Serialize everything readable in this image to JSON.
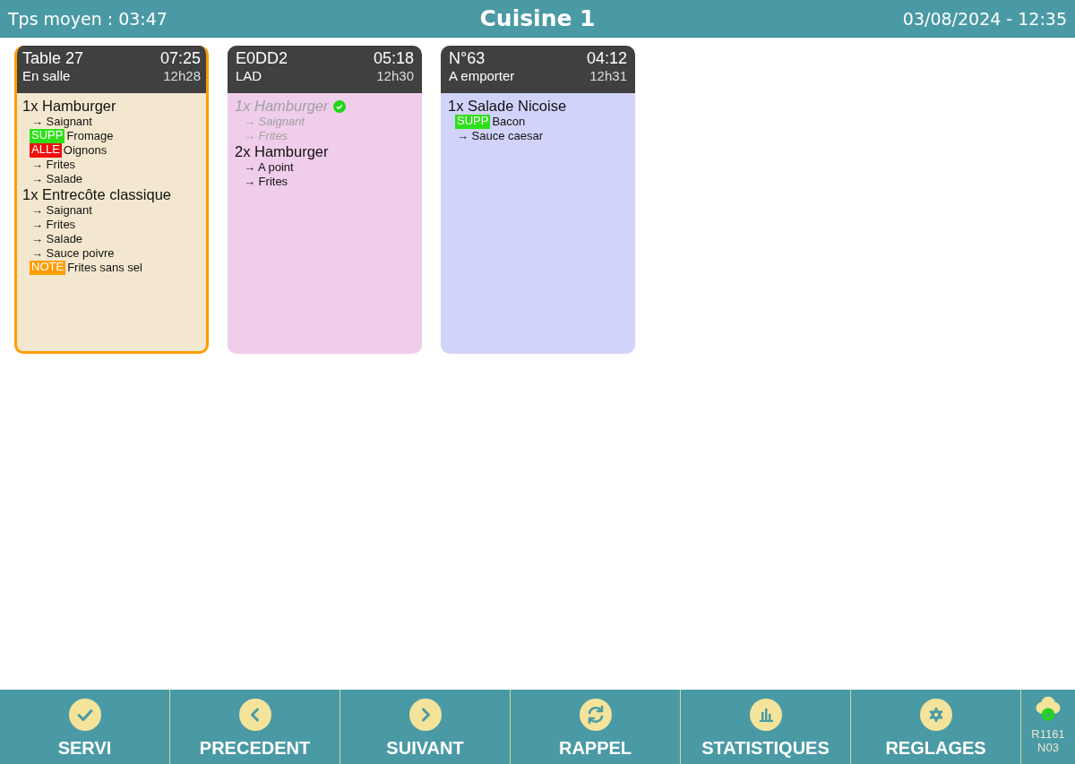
{
  "header": {
    "average_time": "Tps moyen : 03:47",
    "title": "Cuisine 1",
    "datetime": "03/08/2024 - 12:35"
  },
  "orders": [
    {
      "name": "Table 27",
      "timer": "07:25",
      "mode": "En salle",
      "time": "12h28",
      "color": "#f3e8cf",
      "selected": true,
      "items": [
        {
          "text": "1x Hamburger",
          "done": false,
          "lines": [
            {
              "kind": "option",
              "text": "→ Saignant"
            },
            {
              "kind": "tag",
              "tag": "SUPP",
              "color": "#2ee01a",
              "text": "Fromage"
            },
            {
              "kind": "tag",
              "tag": "ALLE",
              "color": "#f01010",
              "text": "Oignons"
            },
            {
              "kind": "option",
              "text": "→ Frites"
            },
            {
              "kind": "option",
              "text": "→ Salade"
            }
          ]
        },
        {
          "text": "1x Entrecôte classique",
          "done": false,
          "lines": [
            {
              "kind": "option",
              "text": "→ Saignant"
            },
            {
              "kind": "option",
              "text": "→ Frites"
            },
            {
              "kind": "option",
              "text": "→ Salade"
            },
            {
              "kind": "option",
              "text": "→ Sauce poivre"
            },
            {
              "kind": "tag",
              "tag": "NOTE",
              "color": "#ff9c00",
              "text": "Frites sans sel"
            }
          ]
        }
      ]
    },
    {
      "name": "E0DD2",
      "timer": "05:18",
      "mode": "LAD",
      "time": "12h30",
      "color": "#f0cdea",
      "selected": false,
      "items": [
        {
          "text": "1x Hamburger",
          "done": true,
          "lines": [
            {
              "kind": "option",
              "text": "→ Saignant"
            },
            {
              "kind": "option",
              "text": "→ Frites"
            }
          ]
        },
        {
          "text": "2x Hamburger",
          "done": false,
          "lines": [
            {
              "kind": "option",
              "text": "→ A point"
            },
            {
              "kind": "option",
              "text": "→ Frites"
            }
          ]
        }
      ]
    },
    {
      "name": "N°63",
      "timer": "04:12",
      "mode": "A emporter",
      "time": "12h31",
      "color": "#d2d3fa",
      "selected": false,
      "items": [
        {
          "text": "1x Salade Nicoise",
          "done": false,
          "lines": [
            {
              "kind": "tag",
              "tag": "SUPP",
              "color": "#2ee01a",
              "text": "Bacon"
            },
            {
              "kind": "option",
              "text": "→ Sauce caesar"
            }
          ]
        }
      ]
    }
  ],
  "toolbar": [
    {
      "kind": "check",
      "label": "SERVI"
    },
    {
      "kind": "prev",
      "label": "PRECEDENT"
    },
    {
      "kind": "next",
      "label": "SUIVANT"
    },
    {
      "kind": "refresh",
      "label": "RAPPEL"
    },
    {
      "kind": "stats",
      "label": "STATISTIQUES"
    },
    {
      "kind": "settings",
      "label": "REGLAGES"
    }
  ],
  "status": {
    "connected": true,
    "lines": [
      "R1161",
      "N03"
    ]
  }
}
